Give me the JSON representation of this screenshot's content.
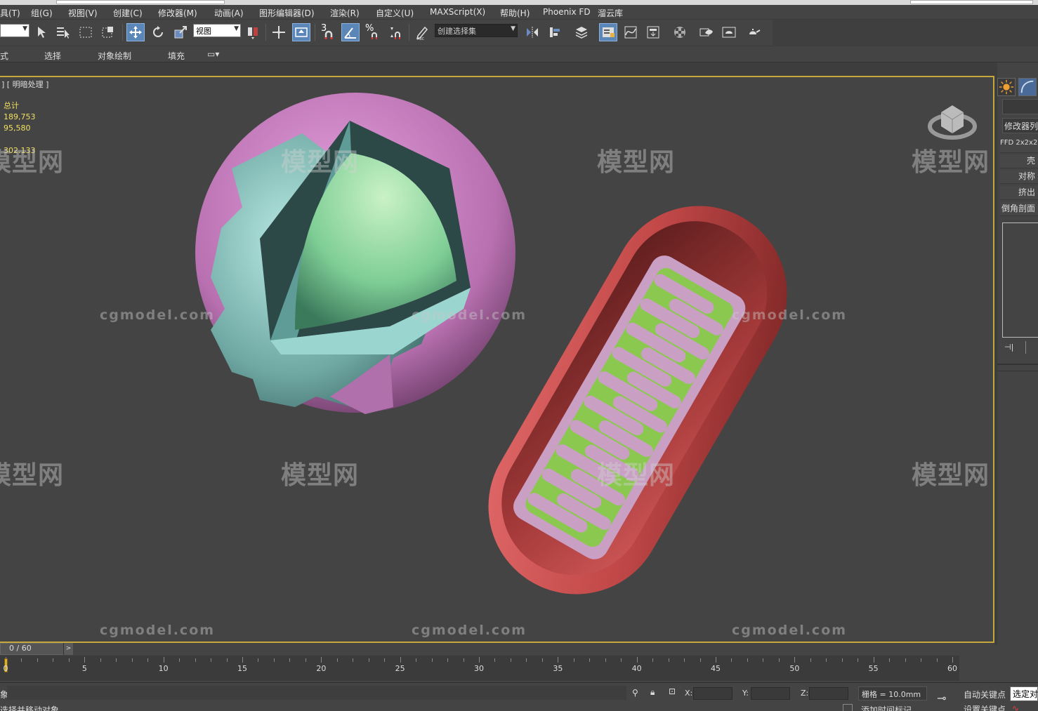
{
  "menu": [
    "具(T)",
    "组(G)",
    "视图(V)",
    "创建(C)",
    "修改器(M)",
    "动画(A)",
    "图形编辑器(D)",
    "渲染(R)",
    "自定义(U)",
    "MAXScript(X)",
    "帮助(H)",
    "Phoenix FD",
    "溜云库"
  ],
  "toolbar": {
    "view_dropdown": "视图",
    "selection_set_dropdown": "创建选择集",
    "snap_label": "3",
    "percent_snap_label": "%"
  },
  "ribbon": {
    "mode": "式",
    "select": "选择",
    "object_paint": "对象绘制",
    "fill": "填充"
  },
  "viewport": {
    "label_suffix": "] [ 明暗处理 ]",
    "stats": {
      "total_label": "总计",
      "polys": "189,753",
      "verts": "95,580",
      "fps": "302.133"
    }
  },
  "watermarks": {
    "cn": "模型网",
    "en": "cgmodel.com"
  },
  "right_panel": {
    "modifier_list": "修改器列表",
    "stack": [
      "FFD 2x2x2",
      "壳",
      "对称",
      "挤出",
      "倒角剖面"
    ]
  },
  "timeline": {
    "frame_display": "0 / 60",
    "next_arrow": ">",
    "ticks": [
      "0",
      "5",
      "10",
      "15",
      "20",
      "25",
      "30",
      "35",
      "40",
      "45",
      "50",
      "55",
      "60"
    ]
  },
  "status": {
    "selection": "象",
    "prompt": "选择并移动对象",
    "x_label": "X:",
    "y_label": "Y:",
    "z_label": "Z:",
    "grid": "栅格 = 10.0mm",
    "auto_key": "自动关键点",
    "selected": "选定对",
    "set_key": "设置关键点",
    "add_time_tag": "添加时间标记"
  },
  "colors": {
    "viewport_border": "#c5a83c",
    "active_button": "#5b86b8",
    "stats_text": "#f0e060"
  }
}
